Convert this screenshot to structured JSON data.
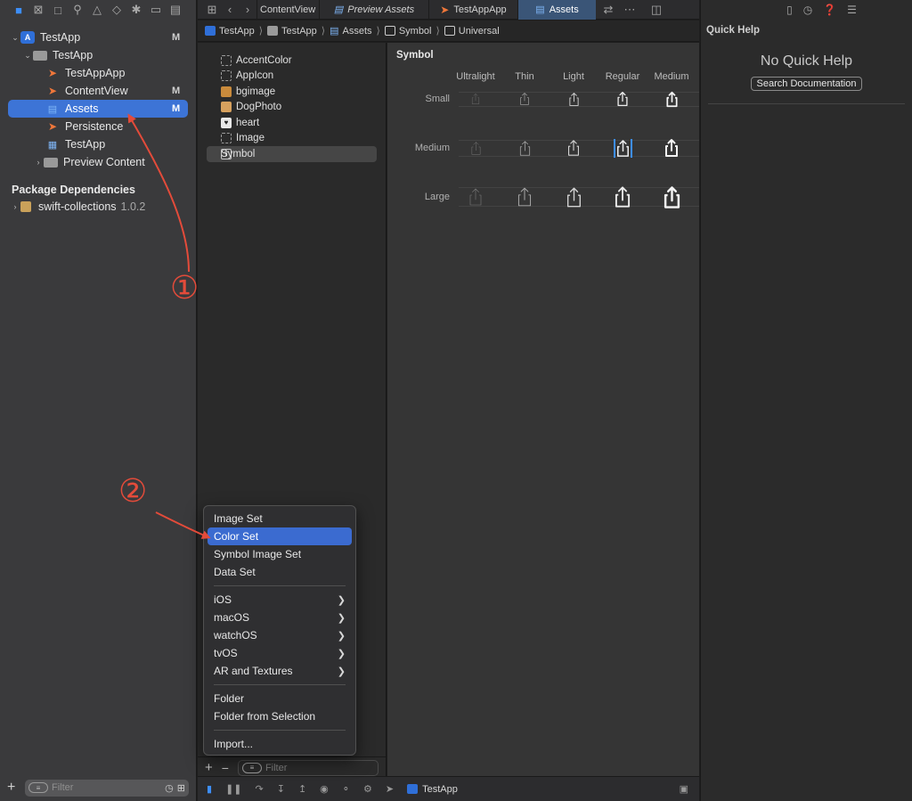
{
  "navigator": {
    "toolbar_icons": [
      "folder-icon",
      "source-control-icon",
      "hierarchy-icon",
      "search-icon",
      "warning-icon",
      "test-icon",
      "debug-icon",
      "breakpoint-icon",
      "report-icon"
    ],
    "tree": [
      {
        "label": "TestApp",
        "badge": "M",
        "icon": "project-icon",
        "level": 0,
        "expanded": true
      },
      {
        "label": "TestApp",
        "badge": "",
        "icon": "folder-icon",
        "level": 1,
        "expanded": true
      },
      {
        "label": "TestAppApp",
        "badge": "",
        "icon": "swift-file-icon",
        "level": 2
      },
      {
        "label": "ContentView",
        "badge": "M",
        "icon": "swift-file-icon",
        "level": 2
      },
      {
        "label": "Assets",
        "badge": "M",
        "icon": "asset-catalog-icon",
        "level": 2,
        "selected": true
      },
      {
        "label": "Persistence",
        "badge": "",
        "icon": "swift-file-icon",
        "level": 2
      },
      {
        "label": "TestApp",
        "badge": "",
        "icon": "data-model-icon",
        "level": 2
      },
      {
        "label": "Preview Content",
        "badge": "",
        "icon": "folder-icon",
        "level": 2,
        "expanded": false
      }
    ],
    "section_header": "Package Dependencies",
    "package": {
      "name": "swift-collections",
      "version": "1.0.2"
    },
    "filter_placeholder": "Filter"
  },
  "tabs": [
    {
      "label": "ContentView",
      "style": "normal"
    },
    {
      "label": "Preview Assets",
      "style": "italic"
    },
    {
      "label": "TestAppApp",
      "style": "normal"
    },
    {
      "label": "Assets",
      "style": "active"
    }
  ],
  "breadcrumb": [
    "TestApp",
    "TestApp",
    "Assets",
    "Symbol",
    "Universal"
  ],
  "asset_list": {
    "items": [
      {
        "label": "AccentColor",
        "kind": "color"
      },
      {
        "label": "AppIcon",
        "kind": "icon"
      },
      {
        "label": "bgimage",
        "kind": "image"
      },
      {
        "label": "DogPhoto",
        "kind": "image"
      },
      {
        "label": "heart",
        "kind": "heart"
      },
      {
        "label": "Image",
        "kind": "empty"
      },
      {
        "label": "Symbol",
        "kind": "symbol",
        "selected": true
      }
    ],
    "filter_placeholder": "Filter"
  },
  "editor": {
    "title": "Symbol",
    "weights": [
      "Ultralight",
      "Thin",
      "Light",
      "Regular",
      "Medium"
    ],
    "scales": [
      "Small",
      "Medium",
      "Large"
    ],
    "selected_cell": {
      "scale": "Medium",
      "weight": "Regular"
    }
  },
  "inspector": {
    "title": "Quick Help",
    "empty_text": "No Quick Help",
    "button_label": "Search Documentation"
  },
  "debug_bar": {
    "scheme": "TestApp"
  },
  "add_menu": {
    "groups": [
      [
        {
          "label": "Image Set"
        },
        {
          "label": "Color Set",
          "highlight": true
        },
        {
          "label": "Symbol Image Set"
        },
        {
          "label": "Data Set"
        }
      ],
      [
        {
          "label": "iOS",
          "submenu": true
        },
        {
          "label": "macOS",
          "submenu": true
        },
        {
          "label": "watchOS",
          "submenu": true
        },
        {
          "label": "tvOS",
          "submenu": true
        },
        {
          "label": "AR and Textures",
          "submenu": true
        }
      ],
      [
        {
          "label": "Folder"
        },
        {
          "label": "Folder from Selection"
        }
      ],
      [
        {
          "label": "Import..."
        }
      ]
    ]
  },
  "annotations": [
    {
      "label": "①",
      "color": "#e34b3a"
    },
    {
      "label": "②",
      "color": "#e34b3a"
    }
  ]
}
